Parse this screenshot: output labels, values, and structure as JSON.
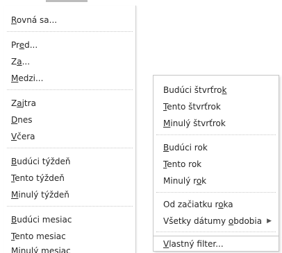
{
  "left_menu": {
    "items": [
      {
        "pre": "",
        "ul": "R",
        "post": "ovná sa..."
      },
      {
        "pre": "Pr",
        "ul": "e",
        "post": "d..."
      },
      {
        "pre": "Z",
        "ul": "a",
        "post": "..."
      },
      {
        "pre": "",
        "ul": "M",
        "post": "edzi..."
      },
      {
        "pre": "Z",
        "ul": "a",
        "post": "jtra"
      },
      {
        "pre": "",
        "ul": "D",
        "post": "nes"
      },
      {
        "pre": "",
        "ul": "V",
        "post": "čera"
      },
      {
        "pre": "",
        "ul": "B",
        "post": "udúci týždeň"
      },
      {
        "pre": "",
        "ul": "T",
        "post": "ento týždeň"
      },
      {
        "pre": "",
        "ul": "M",
        "post": "inulý týždeň"
      },
      {
        "pre": "",
        "ul": "B",
        "post": "udúci mesiac"
      },
      {
        "pre": "",
        "ul": "T",
        "post": "ento mesiac"
      },
      {
        "pre": "",
        "ul": "",
        "post": "Minulý mesiac"
      }
    ]
  },
  "right_menu": {
    "items": [
      {
        "pre": "Budúci štvrťro",
        "ul": "k",
        "post": ""
      },
      {
        "pre": "",
        "ul": "T",
        "post": "ento štvrťrok"
      },
      {
        "pre": "",
        "ul": "M",
        "post": "inulý štvrťrok"
      },
      {
        "pre": "",
        "ul": "B",
        "post": "udúci rok"
      },
      {
        "pre": "",
        "ul": "T",
        "post": "ento rok"
      },
      {
        "pre": "Minulý r",
        "ul": "o",
        "post": "k"
      },
      {
        "pre": "Od začiatku r",
        "ul": "o",
        "post": "ka"
      },
      {
        "pre": "Všetky dátumy ",
        "ul": "o",
        "post": "bdobia",
        "arrow": "▶"
      },
      {
        "pre": "",
        "ul": "V",
        "post": "lastný filter..."
      }
    ]
  }
}
